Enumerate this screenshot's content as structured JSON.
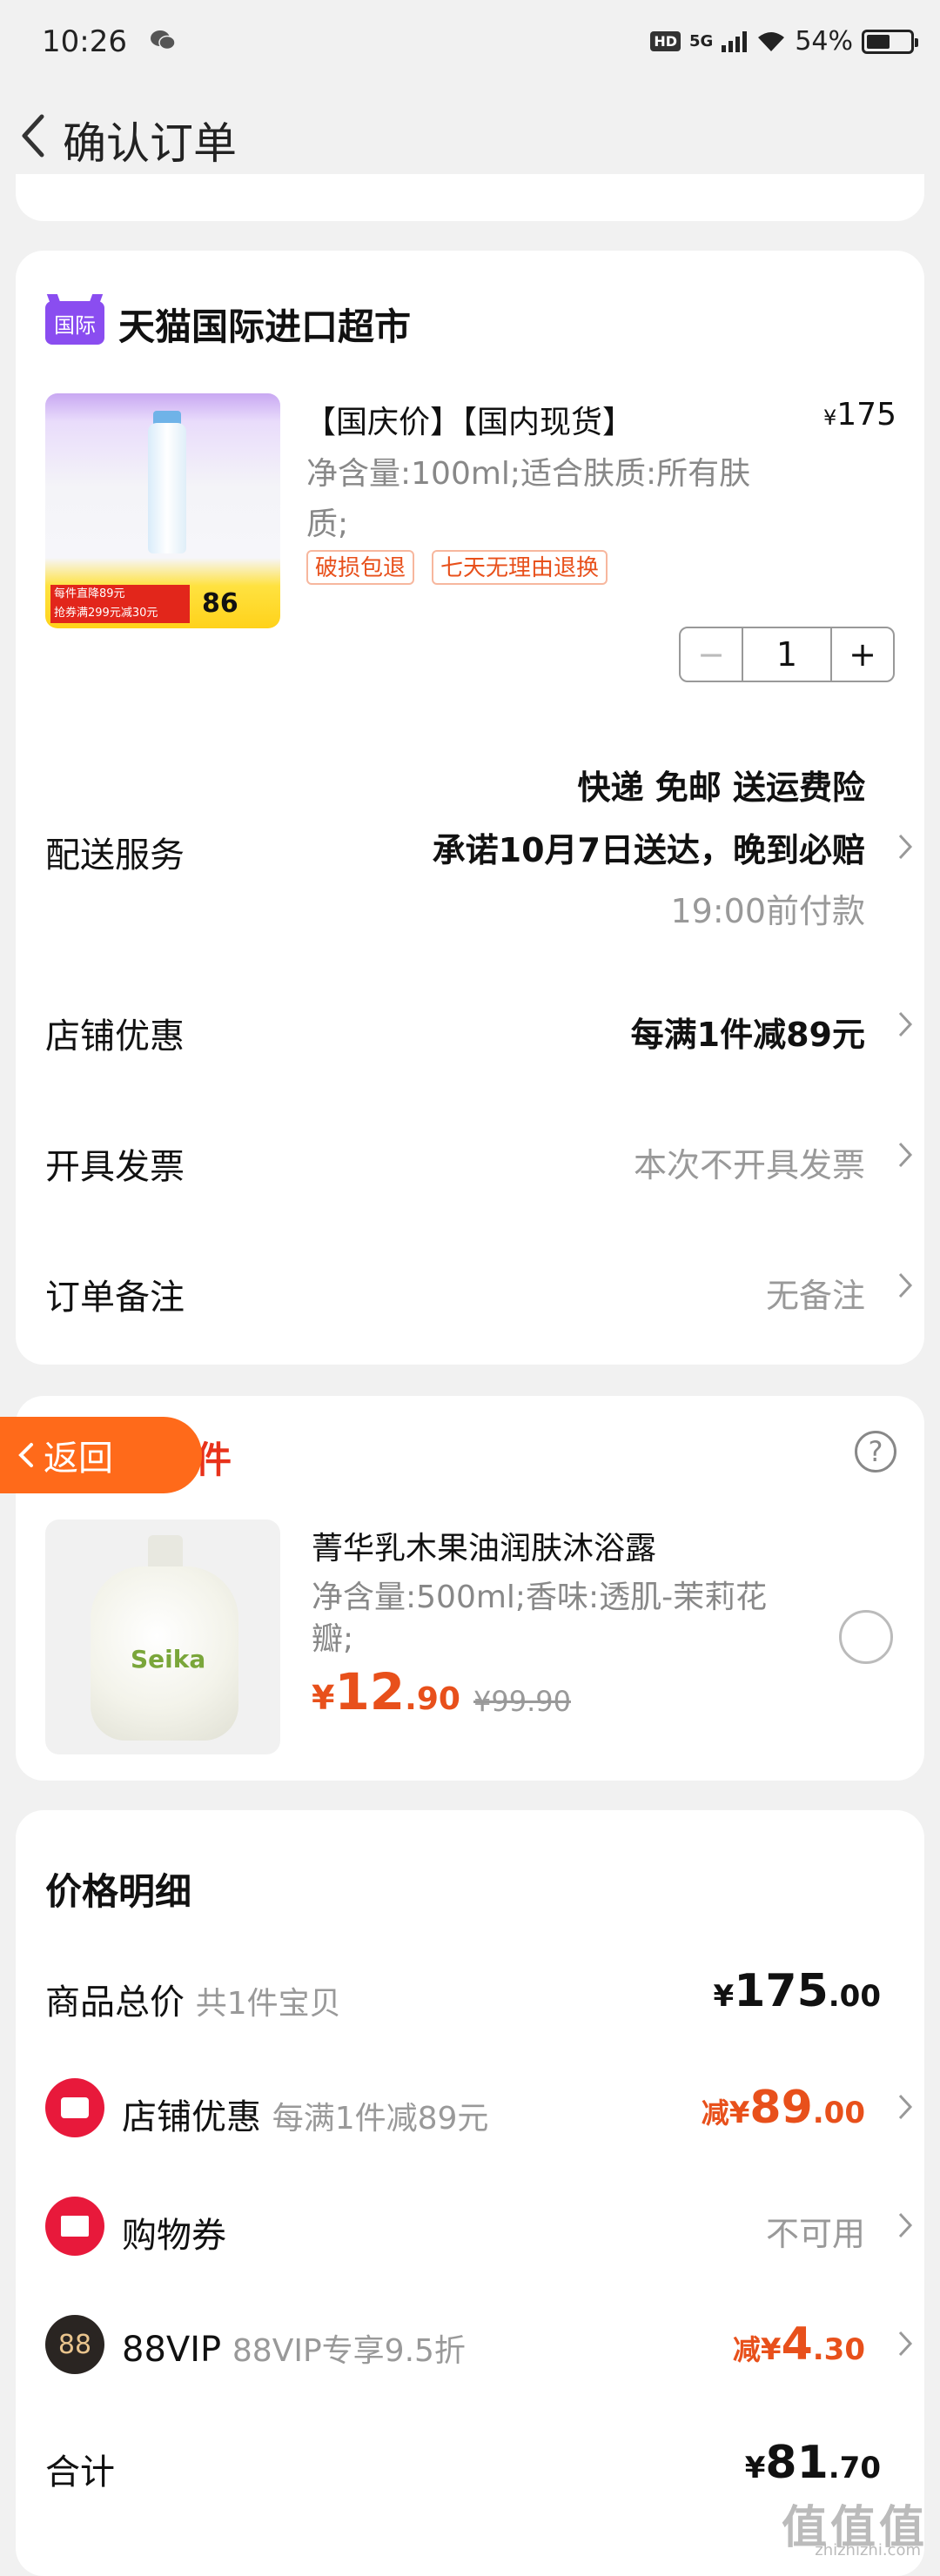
{
  "status": {
    "time": "10:26",
    "hd": "HD",
    "net": "5G",
    "battery": "54%",
    "battery_level": 0.54
  },
  "header": {
    "title": "确认订单"
  },
  "store": {
    "logo": "国际",
    "name": "天猫国际进口超市"
  },
  "product": {
    "title": "【国庆价】【国内现货】",
    "price_currency": "¥",
    "price": "175",
    "spec": "净含量:100ml;适合肤质:所有肤质;",
    "chips": [
      "破损包退",
      "七天无理由退换"
    ],
    "img_tag": "每件直降89元",
    "img_tag2": "抢券满299元减30元",
    "img_num": "86",
    "quantity": "1",
    "minus": "−",
    "plus": "+"
  },
  "delivery": {
    "label": "配送服务",
    "line1": "快递 免邮 送运费险",
    "line2": "承诺10月7日送达，晚到必赔",
    "line3": "19:00前付款"
  },
  "shop_discount": {
    "label": "店铺优惠",
    "value": "每满1件减89元"
  },
  "invoice": {
    "label": "开具发票",
    "value": "本次不开具发票"
  },
  "remark": {
    "label": "订单备注",
    "value": "无备注"
  },
  "recommend": {
    "back": "返回",
    "title": "买一件",
    "help": "?",
    "brand": "Seika",
    "name": "菁华乳木果油润肤沐浴露",
    "spec": "净含量:500ml;香味:透肌-茉莉花瓣;",
    "cur": "¥",
    "int": "12",
    "dec": ".90",
    "orig": "¥99.90"
  },
  "price_detail": {
    "title": "价格明细",
    "total": {
      "label": "商品总价",
      "sub": "共1件宝贝",
      "cur": "¥",
      "int": "175",
      "dec": ".00"
    },
    "shop": {
      "label": "店铺优惠",
      "sub": "每满1件减89元",
      "prefix": "减",
      "cur": "¥",
      "int": "89",
      "dec": ".00"
    },
    "coupon": {
      "label": "购物券",
      "value": "不可用"
    },
    "vip": {
      "icon": "88",
      "label": "88VIP",
      "sub": "88VIP专享9.5折",
      "prefix": "减",
      "cur": "¥",
      "int": "4",
      "dec": ".30"
    },
    "sum": {
      "label": "合计",
      "cur": "¥",
      "int": "81",
      "dec": ".70"
    }
  },
  "watermark": {
    "text": "值值值",
    "sub": "zhizhizhi.com"
  }
}
